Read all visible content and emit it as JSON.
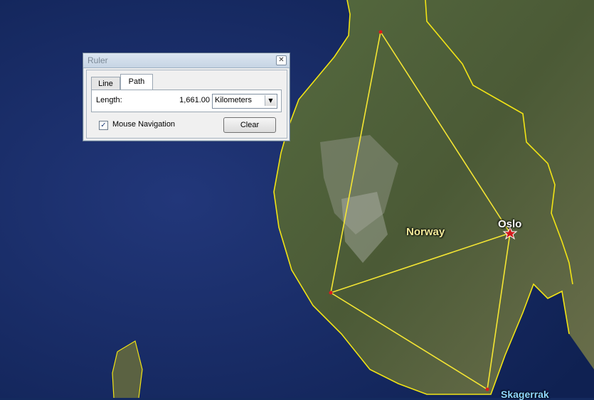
{
  "map": {
    "country_label": "Norway",
    "city_label": "Oslo",
    "sea_label": "Skagerrak"
  },
  "ruler": {
    "title": "Ruler",
    "close_glyph": "✕",
    "tabs": [
      {
        "label": "Line",
        "active": false
      },
      {
        "label": "Path",
        "active": true
      }
    ],
    "length_label": "Length:",
    "length_value": "1,661.00",
    "unit_selected": "Kilometers",
    "mouse_navigation_label": "Mouse Navigation",
    "mouse_navigation_checked": true,
    "clear_label": "Clear"
  },
  "colors": {
    "ocean": "#142a5e",
    "land": "#4e5e3a",
    "path_line": "#f5e633",
    "border_line": "#f2e415",
    "point_marker": "#e01b1b"
  }
}
